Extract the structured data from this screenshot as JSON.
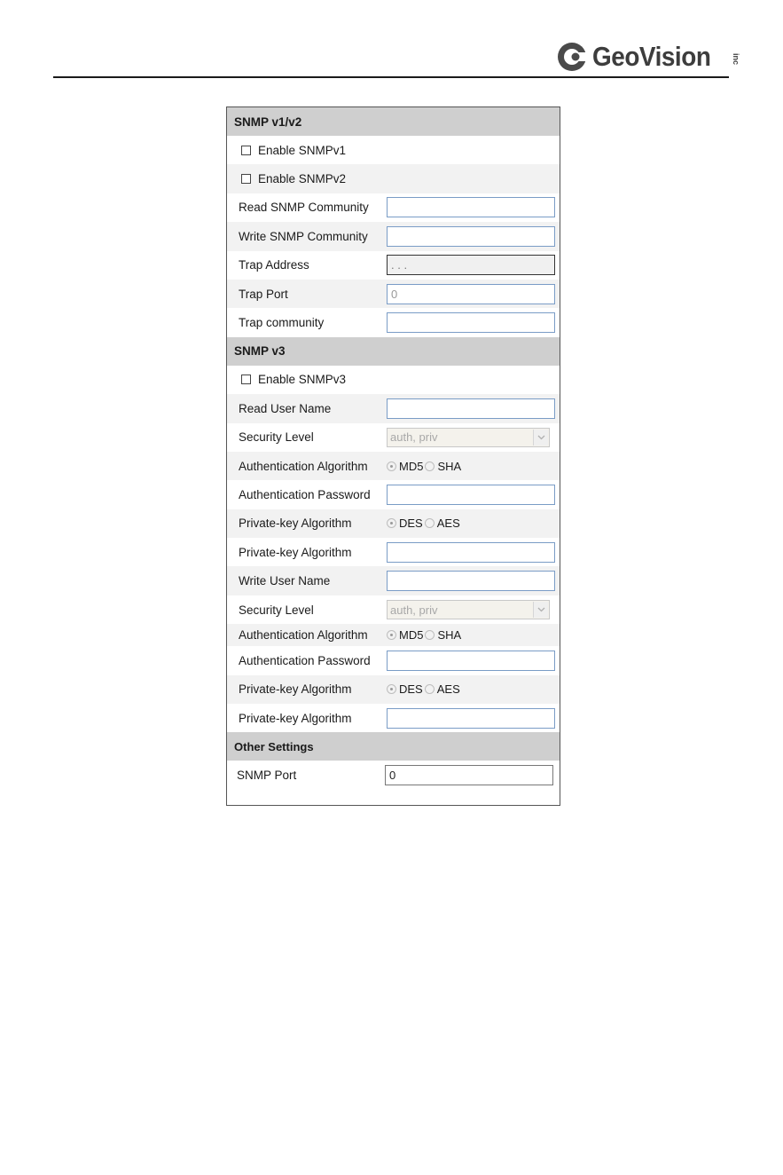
{
  "header": {
    "logo_text": "GeoVision",
    "logo_suffix": "inc"
  },
  "snmp_v1v2": {
    "title": "SNMP v1/v2",
    "enable_v1_label": "Enable SNMPv1",
    "enable_v2_label": "Enable SNMPv2",
    "read_community_label": "Read SNMP Community",
    "read_community_value": "",
    "write_community_label": "Write SNMP Community",
    "write_community_value": "",
    "trap_address_label": "Trap Address",
    "trap_address_value": ". . .",
    "trap_port_label": "Trap Port",
    "trap_port_value": "0",
    "trap_community_label": "Trap community",
    "trap_community_value": ""
  },
  "snmp_v3": {
    "title": "SNMP v3",
    "enable_v3_label": "Enable SNMPv3",
    "read_user_label": "Read User Name",
    "read_user_value": "",
    "read_security_label": "Security Level",
    "read_security_value": "auth, priv",
    "read_auth_algo_label": "Authentication Algorithm",
    "read_auth_opt1": "MD5",
    "read_auth_opt2": "SHA",
    "read_auth_pw_label": "Authentication Password",
    "read_auth_pw_value": "",
    "read_priv_algo_label": "Private-key Algorithm",
    "read_priv_opt1": "DES",
    "read_priv_opt2": "AES",
    "read_priv_key_label": "Private-key Algorithm",
    "read_priv_key_value": "",
    "write_user_label": "Write User Name",
    "write_user_value": "",
    "write_security_label": "Security Level",
    "write_security_value": "auth, priv",
    "write_auth_algo_label": "Authentication Algorithm",
    "write_auth_opt1": "MD5",
    "write_auth_opt2": "SHA",
    "write_auth_pw_label": "Authentication Password",
    "write_auth_pw_value": "",
    "write_priv_algo_label": "Private-key Algorithm",
    "write_priv_opt1": "DES",
    "write_priv_opt2": "AES",
    "write_priv_key_label": "Private-key Algorithm",
    "write_priv_key_value": ""
  },
  "other": {
    "title": "Other Settings",
    "snmp_port_label": "SNMP Port",
    "snmp_port_value": "0"
  },
  "colors": {
    "section_header_bg": "#cfcfcf",
    "alt_row_bg": "#f2f2f2",
    "input_border": "#7a9cc6"
  }
}
